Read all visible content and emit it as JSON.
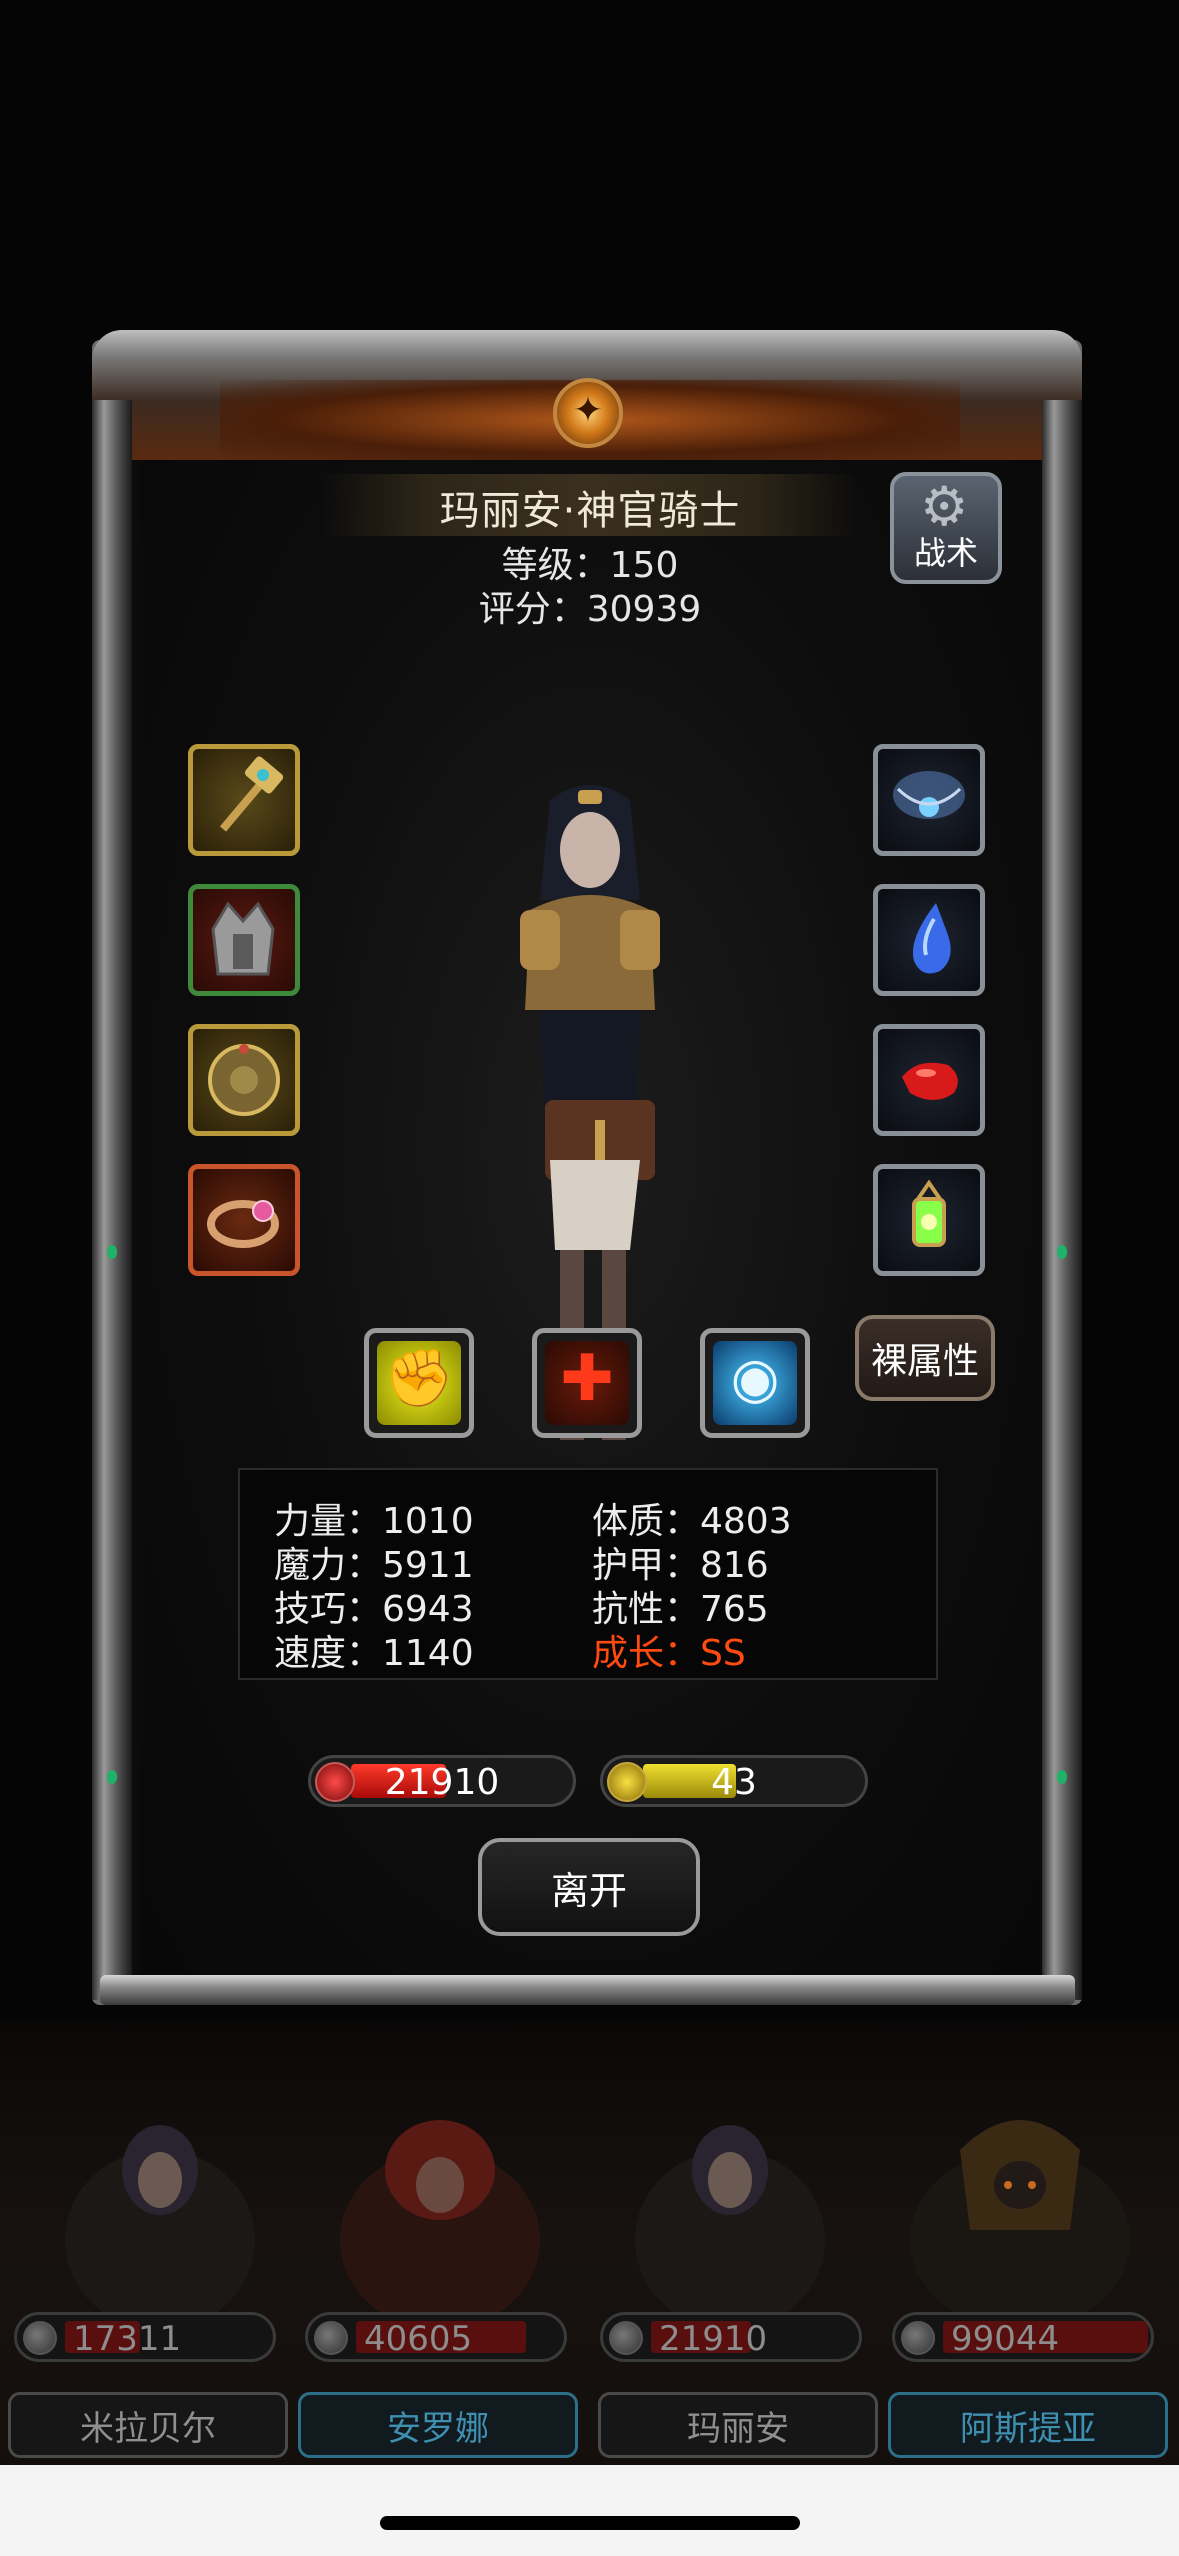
{
  "hero": {
    "title": "玛丽安·神官骑士",
    "level": "等级：150",
    "score": "评分：30939"
  },
  "tactics_button": {
    "label": "战术",
    "icon": "gear-icon"
  },
  "equipment": {
    "left": [
      {
        "name": "hammer-slot",
        "icon": "war-hammer-icon"
      },
      {
        "name": "armor-slot",
        "icon": "spiked-armor-icon"
      },
      {
        "name": "shield-slot",
        "icon": "round-shield-icon"
      },
      {
        "name": "ring-slot",
        "icon": "ring-icon"
      }
    ],
    "right": [
      {
        "name": "amulet-slot",
        "icon": "amulet-icon"
      },
      {
        "name": "blue-gem-slot",
        "icon": "blue-droplet-gem-icon"
      },
      {
        "name": "red-gem-slot",
        "icon": "red-stone-icon"
      },
      {
        "name": "lantern-slot",
        "icon": "lantern-icon"
      }
    ]
  },
  "skills": [
    {
      "name": "power-skill",
      "icon": "fist-icon"
    },
    {
      "name": "heal-skill",
      "icon": "cross-icon"
    },
    {
      "name": "vision-skill",
      "icon": "eye-icon"
    }
  ],
  "naked_attr_button": "裸属性",
  "stats": {
    "strength": "力量：1010",
    "constitution": "体质：4803",
    "magic": "魔力：5911",
    "armor": "护甲：816",
    "skill": "技巧：6943",
    "resistance": "抗性：765",
    "speed": "速度：1140",
    "growth": "成长：SS"
  },
  "bars": {
    "hp": {
      "value": "21910",
      "fill_fraction": 0.44
    },
    "energy": {
      "value": "43",
      "fill_fraction": 0.43
    }
  },
  "leave_button": "离开",
  "roster": [
    {
      "name": "米拉贝尔",
      "hp": "17311",
      "selected": false
    },
    {
      "name": "安罗娜",
      "hp": "40605",
      "selected": true
    },
    {
      "name": "玛丽安",
      "hp": "21910",
      "selected": false
    },
    {
      "name": "阿斯提亚",
      "hp": "99044",
      "selected": true
    }
  ],
  "colors": {
    "growth_text": "#ff4a10",
    "hp_fill": "#d81a1a",
    "energy_fill": "#d6c216",
    "frame_gold": "#b89a3a"
  }
}
